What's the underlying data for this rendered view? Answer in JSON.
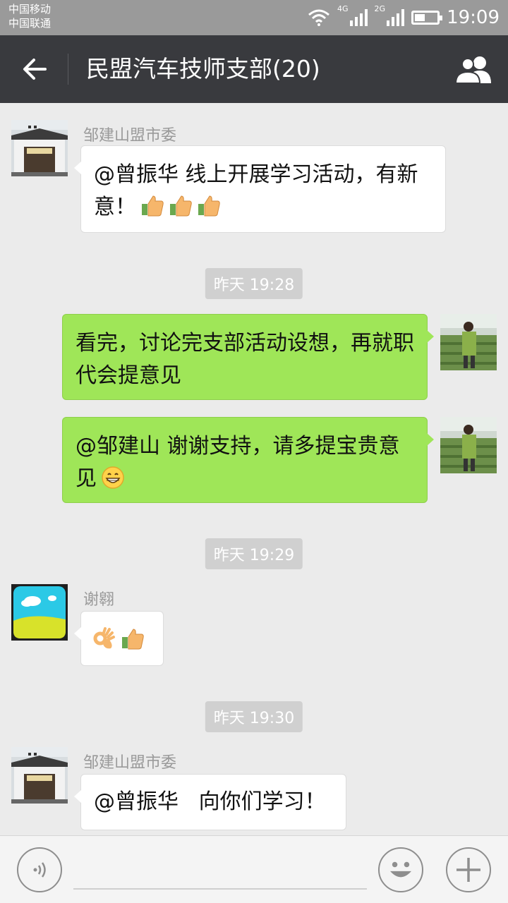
{
  "status_bar": {
    "carrier_1": "中国移动",
    "carrier_2": "中国联通",
    "network_1": "4G",
    "network_2": "2G",
    "time": "19:09"
  },
  "header": {
    "back_icon": "arrow-left-icon",
    "title": "民盟汽车技师支部(20)",
    "group_icon": "group-members-icon"
  },
  "messages": [
    {
      "type": "incoming",
      "sender": "邹建山盟市委",
      "text": "@曾振华 线上开展学习活动，有新意！",
      "emojis": [
        "thumbs-up",
        "thumbs-up",
        "thumbs-up"
      ]
    },
    {
      "type": "timestamp",
      "text": "昨天 19:28"
    },
    {
      "type": "outgoing",
      "text": "看完，讨论完支部活动设想，再就职代会提意见"
    },
    {
      "type": "outgoing",
      "text": "@邹建山 谢谢支持，请多提宝贵意见",
      "emojis": [
        "grin"
      ]
    },
    {
      "type": "timestamp",
      "text": "昨天 19:29"
    },
    {
      "type": "incoming",
      "sender": "谢翱",
      "text": "",
      "emojis": [
        "ok-hand",
        "thumbs-up"
      ]
    },
    {
      "type": "timestamp",
      "text": "昨天 19:30"
    },
    {
      "type": "incoming",
      "sender": "邹建山盟市委",
      "text": "@曾振华   向你们学习！"
    }
  ],
  "input_bar": {
    "voice_icon": "voice-icon",
    "placeholder": "",
    "emoji_icon": "emoji-icon",
    "plus_icon": "plus-icon"
  },
  "colors": {
    "titlebar": "#393a3e",
    "outgoing_bubble": "#9fe658",
    "background": "#ebebeb"
  }
}
